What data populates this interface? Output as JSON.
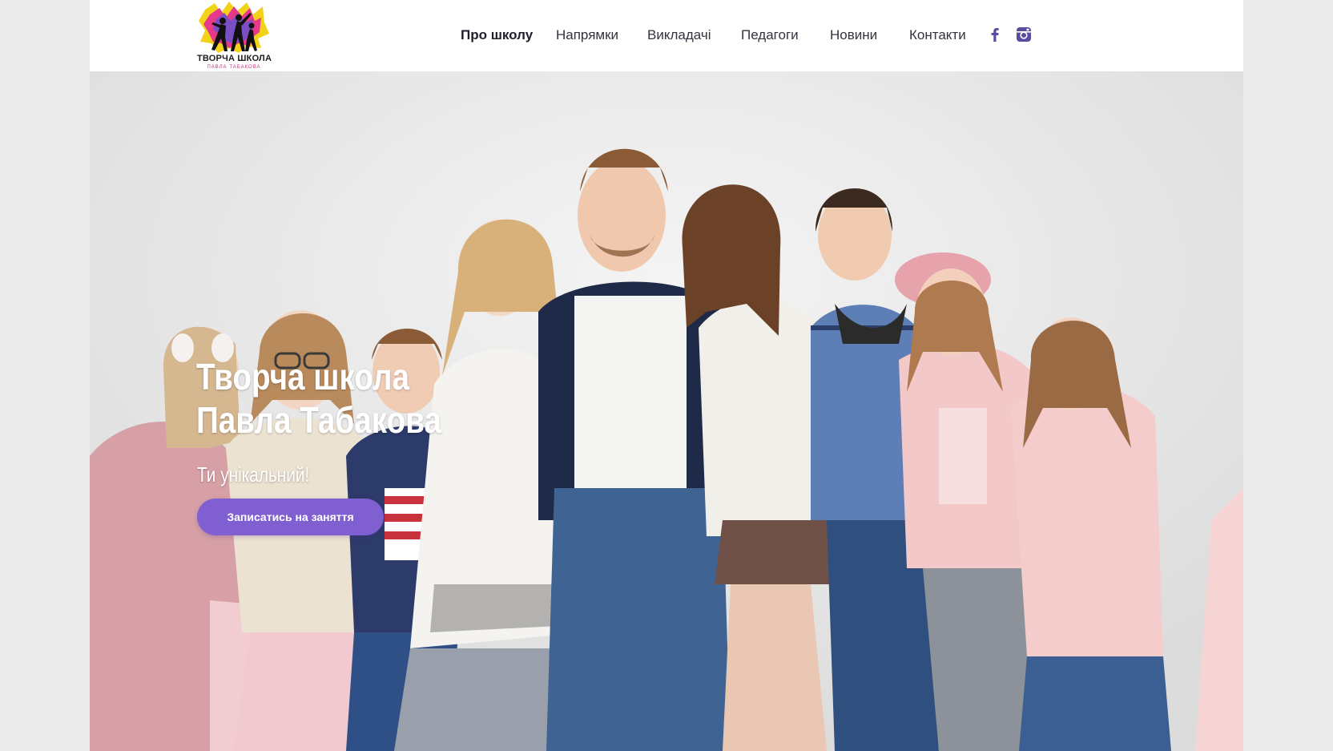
{
  "brand": {
    "logo_title": "ТВОРЧА ШКОЛА",
    "logo_subtitle": "ПАВЛА ТАБАКОВА"
  },
  "nav": {
    "items": [
      {
        "label": "Про школу",
        "active": true
      },
      {
        "label": "Напрямки",
        "active": false
      },
      {
        "label": "Викладачі",
        "active": false
      },
      {
        "label": "Педагоги",
        "active": false
      },
      {
        "label": "Новини",
        "active": false
      },
      {
        "label": "Контакти",
        "active": false
      }
    ],
    "social": [
      {
        "icon": "facebook-icon"
      },
      {
        "icon": "instagram-icon"
      }
    ]
  },
  "hero": {
    "title": "Творча школа Павла Табакова",
    "subtitle": "Ти унікальний!",
    "cta_label": "Записатись на заняття",
    "photo_icon": "group-photo"
  },
  "colors": {
    "accent": "#8060d0",
    "social_icon": "#5b4a9e",
    "nav_text": "#333340",
    "page_background": "#eaeaea"
  }
}
